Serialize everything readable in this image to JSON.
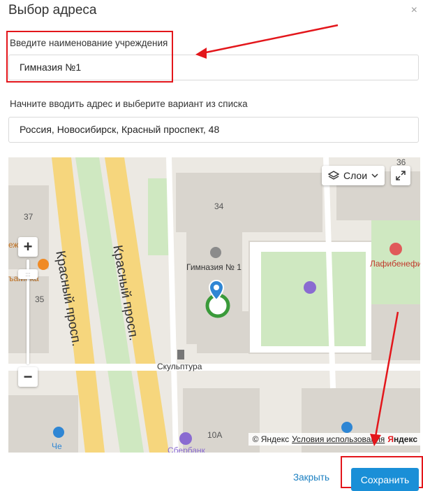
{
  "dialog": {
    "title": "Выбор адреса",
    "close_glyph": "×"
  },
  "institution": {
    "label": "Введите наименование учреждения",
    "value": "Гимназия №1"
  },
  "address": {
    "label": "Начните вводить адрес и выберите вариант из списка",
    "value": "Россия, Новосибирск, Красный проспект, 48"
  },
  "map": {
    "layers_label": "Слои",
    "zoom_in": "+",
    "zoom_out": "−",
    "streets": [
      "Красный просп.",
      "Красный просп."
    ],
    "building_numbers": [
      "34",
      "37",
      "35",
      "10А",
      "36"
    ],
    "places": {
      "gymnasium": "Гимназия № 1",
      "sculpture": "Скульптура",
      "cafe": "Лафибенефи",
      "left_cafe": "ъaMuka",
      "left_top": "еж",
      "sberbank": "Сбербанк",
      "che": "Че"
    },
    "attribution": {
      "copyright": "© Яндекс",
      "terms": "Условия использования",
      "logo_ya": "Я",
      "logo_rest": "ндекс"
    }
  },
  "footer": {
    "close_label": "Закрыть",
    "save_label": "Сохранить"
  },
  "colors": {
    "annotation_red": "#e3161b",
    "primary_button": "#1a8fd7",
    "link": "#1a7fc1"
  }
}
